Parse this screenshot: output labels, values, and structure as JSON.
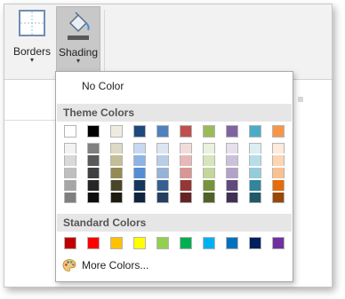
{
  "ribbon": {
    "borders_label": "Borders",
    "shading_label": "Shading",
    "dropdown_arrow": "▾",
    "icons": {
      "borders": "borders-icon",
      "shading": "paint-bucket-icon"
    }
  },
  "menu": {
    "no_color_label": "No Color",
    "theme_colors_title": "Theme Colors",
    "standard_colors_title": "Standard Colors",
    "more_colors_label": "More Colors...",
    "more_colors_icon": "palette-icon"
  },
  "theme_colors": [
    {
      "base": "#ffffff",
      "tints": [
        "#f2f2f2",
        "#d9d9d9",
        "#bfbfbf",
        "#a6a6a6",
        "#7f7f7f"
      ]
    },
    {
      "base": "#000000",
      "tints": [
        "#808080",
        "#595959",
        "#404040",
        "#262626",
        "#0d0d0d"
      ]
    },
    {
      "base": "#eeece1",
      "tints": [
        "#ddd9c4",
        "#c4bd97",
        "#948a54",
        "#4a452a",
        "#1e1c11"
      ]
    },
    {
      "base": "#1f497d",
      "tints": [
        "#c6d9f1",
        "#8eb4e3",
        "#558ed5",
        "#17375e",
        "#10243f"
      ]
    },
    {
      "base": "#4f81bd",
      "tints": [
        "#dce6f2",
        "#b9cde5",
        "#95b3d7",
        "#376092",
        "#254061"
      ]
    },
    {
      "base": "#c0504d",
      "tints": [
        "#f2dcdb",
        "#e6b9b8",
        "#d99694",
        "#953735",
        "#632523"
      ]
    },
    {
      "base": "#9bbb59",
      "tints": [
        "#ebf1de",
        "#d7e4bd",
        "#c3d69b",
        "#77933c",
        "#4f6228"
      ]
    },
    {
      "base": "#8064a2",
      "tints": [
        "#e6e0ec",
        "#ccc1da",
        "#b3a2c7",
        "#604a7b",
        "#403152"
      ]
    },
    {
      "base": "#4bacc6",
      "tints": [
        "#dbeef4",
        "#b7dee8",
        "#93cddd",
        "#31859c",
        "#215968"
      ]
    },
    {
      "base": "#f79646",
      "tints": [
        "#fdeada",
        "#fcd5b5",
        "#fac090",
        "#e46c0a",
        "#984807"
      ]
    }
  ],
  "standard_colors": [
    "#c00000",
    "#ff0000",
    "#ffc000",
    "#ffff00",
    "#92d050",
    "#00b050",
    "#00b0f0",
    "#0070c0",
    "#002060",
    "#7030a0"
  ]
}
